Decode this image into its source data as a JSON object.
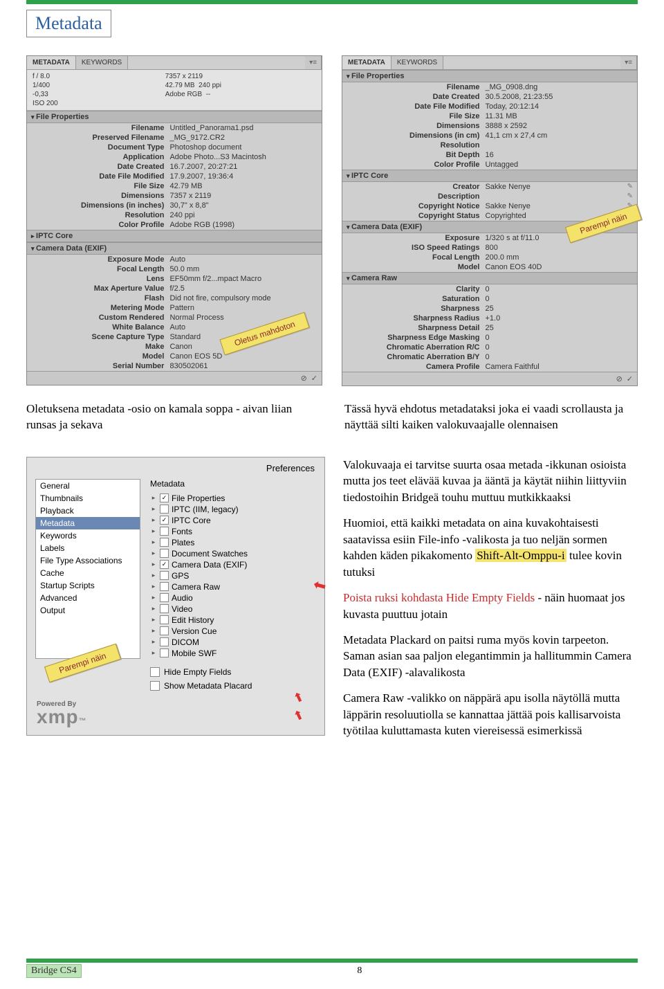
{
  "title": "Metadata",
  "panelA": {
    "tabs": [
      "METADATA",
      "KEYWORDS"
    ],
    "cam": {
      "f": "f / 8.0",
      "sh": "1/400",
      "ev": "-0,33",
      "iso": "ISO 200",
      "dim": "7357 x 2119",
      "size": "42.79 MB",
      "ppi": "240 ppi",
      "cs": "Adobe RGB",
      "dash": "--"
    },
    "fileProps": {
      "title": "File Properties",
      "rows": [
        [
          "Filename",
          "Untitled_Panorama1.psd"
        ],
        [
          "Preserved Filename",
          "_MG_9172.CR2"
        ],
        [
          "Document Type",
          "Photoshop document"
        ],
        [
          "Application",
          "Adobe Photo...S3 Macintosh"
        ],
        [
          "Date Created",
          "16.7.2007, 20:27:21"
        ],
        [
          "Date File Modified",
          "17.9.2007, 19:36:4"
        ],
        [
          "File Size",
          "42.79 MB"
        ],
        [
          "Dimensions",
          "7357 x 2119"
        ],
        [
          "Dimensions (in inches)",
          "30,7\" x 8,8\""
        ],
        [
          "Resolution",
          "240 ppi"
        ],
        [
          "Color Profile",
          "Adobe RGB (1998)"
        ]
      ]
    },
    "iptc": "IPTC Core",
    "exif": {
      "title": "Camera Data (EXIF)",
      "rows": [
        [
          "Exposure Mode",
          "Auto"
        ],
        [
          "Focal Length",
          "50.0 mm"
        ],
        [
          "Lens",
          "EF50mm f/2...mpact Macro"
        ],
        [
          "Max Aperture Value",
          "f/2.5"
        ],
        [
          "Flash",
          "Did not fire, compulsory mode"
        ],
        [
          "Metering Mode",
          "Pattern"
        ],
        [
          "Custom Rendered",
          "Normal Process"
        ],
        [
          "White Balance",
          "Auto"
        ],
        [
          "Scene Capture Type",
          "Standard"
        ],
        [
          "Make",
          "Canon"
        ],
        [
          "Model",
          "Canon EOS 5D"
        ],
        [
          "Serial Number",
          "830502061"
        ]
      ]
    },
    "callout": "Oletus mahdoton"
  },
  "panelB": {
    "tabs": [
      "METADATA",
      "KEYWORDS"
    ],
    "fileProps": {
      "title": "File Properties",
      "rows": [
        [
          "Filename",
          "_MG_0908.dng"
        ],
        [
          "Date Created",
          "30.5.2008, 21:23:55"
        ],
        [
          "Date File Modified",
          "Today, 20:12:14"
        ],
        [
          "File Size",
          "11.31 MB"
        ],
        [
          "Dimensions",
          "3888 x 2592"
        ],
        [
          "Dimensions (in cm)",
          "41,1 cm x 27,4 cm"
        ],
        [
          "Resolution",
          ""
        ],
        [
          "Bit Depth",
          "16"
        ],
        [
          "Color Profile",
          "Untagged"
        ]
      ]
    },
    "iptc": {
      "title": "IPTC Core",
      "rows": [
        [
          "Creator",
          "Sakke Nenye"
        ],
        [
          "Description",
          ""
        ],
        [
          "Copyright Notice",
          "Sakke Nenye"
        ],
        [
          "Copyright Status",
          "Copyrighted"
        ]
      ]
    },
    "exif": {
      "title": "Camera Data (EXIF)",
      "rows": [
        [
          "Exposure",
          "1/320 s at f/11.0"
        ],
        [
          "ISO Speed Ratings",
          "800"
        ],
        [
          "Focal Length",
          "200.0 mm"
        ],
        [
          "Model",
          "Canon EOS 40D"
        ]
      ]
    },
    "raw": {
      "title": "Camera Raw",
      "rows": [
        [
          "Clarity",
          "0"
        ],
        [
          "Saturation",
          "0"
        ],
        [
          "Sharpness",
          "25"
        ],
        [
          "Sharpness Radius",
          "+1.0"
        ],
        [
          "Sharpness Detail",
          "25"
        ],
        [
          "Sharpness Edge Masking",
          "0"
        ],
        [
          "Chromatic Aberration R/C",
          "0"
        ],
        [
          "Chromatic Aberration B/Y",
          "0"
        ],
        [
          "Camera Profile",
          "Camera Faithful"
        ]
      ]
    },
    "callout": "Parempi näin"
  },
  "captionA": "Oletuksena metadata -osio on kamala soppa - aivan liian runsas ja sekava",
  "captionB": "Tässä hyvä ehdotus metadataksi joka ei vaadi scrollausta ja näyttää silti kaiken valokuvaajalle olennaisen",
  "prefs": {
    "title": "Preferences",
    "cats": [
      "General",
      "Thumbnails",
      "Playback",
      "Metadata",
      "Keywords",
      "Labels",
      "File Type Associations",
      "Cache",
      "Startup Scripts",
      "Advanced",
      "Output"
    ],
    "sel": "Metadata",
    "metaLabel": "Metadata",
    "items": [
      {
        "c": true,
        "t": "File Properties"
      },
      {
        "c": false,
        "t": "IPTC (IIM, legacy)"
      },
      {
        "c": true,
        "t": "IPTC Core"
      },
      {
        "c": false,
        "t": "Fonts"
      },
      {
        "c": false,
        "t": "Plates"
      },
      {
        "c": false,
        "t": "Document Swatches"
      },
      {
        "c": true,
        "t": "Camera Data (EXIF)"
      },
      {
        "c": false,
        "t": "GPS"
      },
      {
        "c": false,
        "t": "Camera Raw"
      },
      {
        "c": false,
        "t": "Audio"
      },
      {
        "c": false,
        "t": "Video"
      },
      {
        "c": false,
        "t": "Edit History"
      },
      {
        "c": false,
        "t": "Version Cue"
      },
      {
        "c": false,
        "t": "DICOM"
      },
      {
        "c": false,
        "t": "Mobile SWF"
      }
    ],
    "hide": "Hide Empty Fields",
    "plac": "Show Metadata Placard",
    "powered": "Powered By",
    "xmp": "xmp",
    "callout": "Parempi näin"
  },
  "body": {
    "p1": "Valokuvaaja ei tarvitse suurta osaa metada -ikkunan osioista mutta jos teet elävää kuvaa ja ääntä ja käytät niihin liittyviin tiedostoihin Bridgeä touhu muttuu mutkikkaaksi",
    "p2a": "Huomioi, että kaikki metadata on aina kuvakohtaisesti saatavissa esiin File-info -valikosta ja tuo neljän sormen kahden käden pikakomento ",
    "p2h": "Shift-Alt-Omppu-i",
    "p2b": " tulee kovin tutuksi",
    "p3a": "Poista ruksi kohdasta Hide Empty Fields",
    "p3b": " - näin huomaat jos kuvasta puuttuu jotain",
    "p4": "Metadata Plackard on paitsi ruma myös kovin tarpeeton. Saman asian saa paljon elegantimmin ja hallitummin Camera Data (EXIF) -alavalikosta",
    "p5": "Camera Raw -valikko on näppärä apu isolla näytöllä mutta läppärin resoluutiolla se kannattaa jättää pois kallisarvoista työtilaa kuluttamasta kuten viereisessä esimerkissä"
  },
  "footer": {
    "label": "Bridge CS4",
    "page": "8"
  }
}
